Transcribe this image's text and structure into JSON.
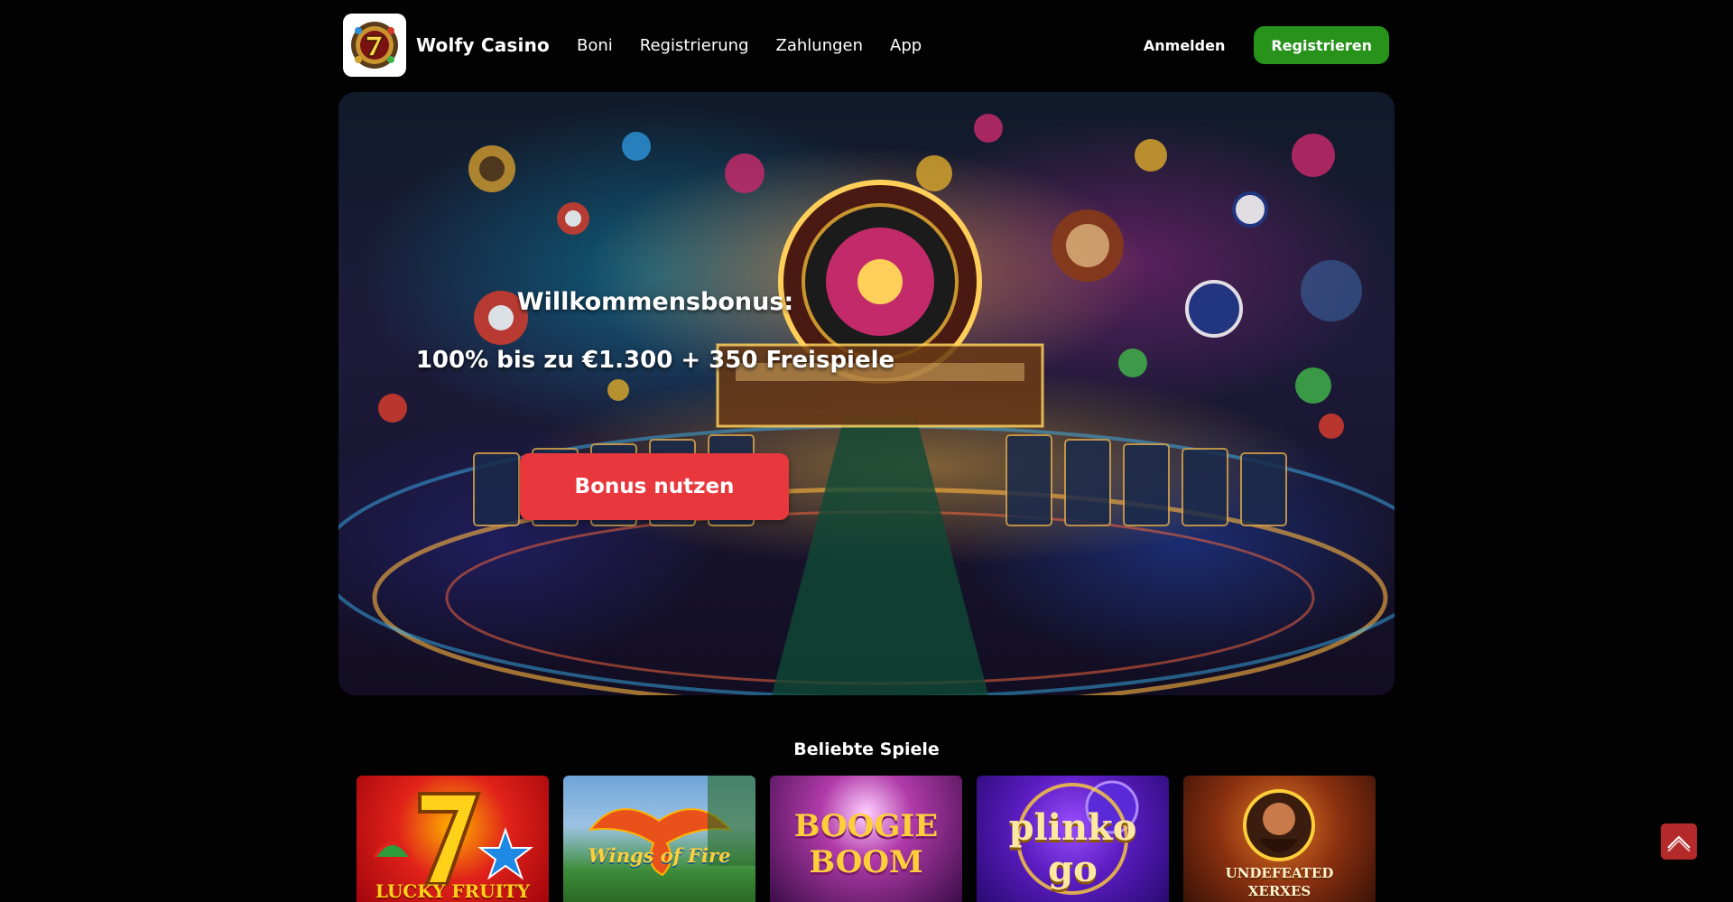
{
  "header": {
    "brand": "Wolfy Casino",
    "nav": [
      "Boni",
      "Registrierung",
      "Zahlungen",
      "App"
    ],
    "login_label": "Anmelden",
    "register_label": "Registrieren"
  },
  "hero": {
    "bonus_title": "Willkommensbonus:",
    "bonus_offer": "100% bis zu €1.300 + 350 Freispiele",
    "cta_label": "Bonus nutzen"
  },
  "popular": {
    "title": "Beliebte Spiele",
    "games": [
      {
        "name": "LUCKY FRUITY"
      },
      {
        "name": "Wings of Fire"
      },
      {
        "name": "BOOGIE BOOM"
      },
      {
        "name": "plinko go"
      },
      {
        "name": "UNDEFEATED XERXES"
      }
    ]
  },
  "colors": {
    "background": "#020203",
    "register_button": "#27931b",
    "cta_button": "#e8373d",
    "scroll_top": "#b42a2a"
  },
  "icons": {
    "logo": "lucky-seven-logo-icon",
    "scroll_top": "chevron-up-icon"
  }
}
